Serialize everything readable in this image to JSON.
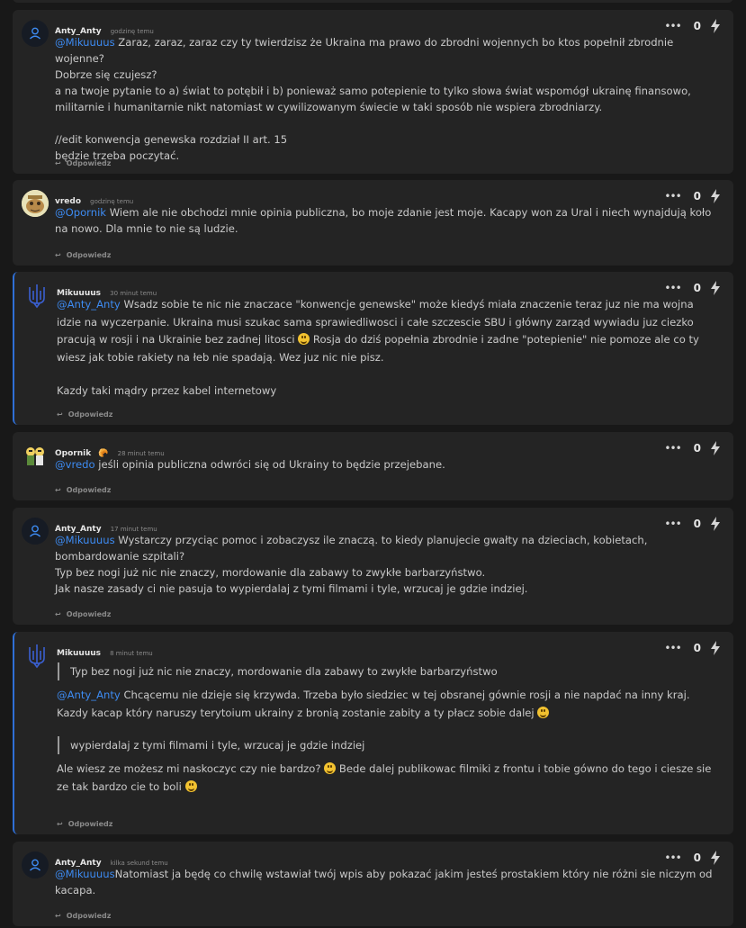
{
  "comments": [
    {
      "author": "Anty_Anty",
      "time": "godzinę temu",
      "score": "0",
      "reply_label": "Odpowiedz",
      "mention": "@Mikuuuus",
      "lines": [
        " Zaraz, zaraz, zaraz czy ty twierdzisz że Ukraina ma prawo do zbrodni wojennych bo ktos popełnił zbrodnie wojenne?",
        "Dobrze się czujesz?",
        "a na twoje pytanie to a) świat to potębił i b) ponieważ samo potepienie to tylko słowa świat wspomógł ukrainę finansowo, militarnie i humanitarnie nikt natomiast w cywilizowanym świecie w taki sposób nie wspiera zbrodniarzy.",
        "//edit konwencja genewska rozdział II art. 15",
        "będzie trzeba poczytać."
      ]
    },
    {
      "author": "vredo",
      "time": "godzinę temu",
      "score": "0",
      "reply_label": "Odpowiedz",
      "mention": "@Opornik",
      "text": " Wiem ale nie obchodzi mnie opinia publiczna, bo moje zdanie jest moje. Kacapy won za Ural i niech wynajdują koło na nowo. Dla mnie to nie są ludzie."
    },
    {
      "author": "Mikuuuus",
      "time": "30 minut temu",
      "score": "0",
      "reply_label": "Odpowiedz",
      "mention": "@Anty_Anty",
      "text_a": " Wsadz sobie te nic nie znaczace \"konwencje genewske\" może kiedyś miała znaczenie teraz juz nie ma wojna idzie na wyczerpanie. Ukraina musi szukac sama sprawiedliwosci i całe szczescie SBU i główny zarząd wywiadu juz ciezko pracują w rosji i na Ukrainie bez zadnej litosci ",
      "text_b": " Rosja do dziś popełnia zbrodnie i zadne \"potepienie\" nie pomoze ale co ty wiesz jak tobie rakiety na łeb nie spadają. Wez juz nic nie pisz.",
      "last": "Kazdy taki mądry przez kabel internetowy"
    },
    {
      "author": "Opornik",
      "time": "28 minut temu",
      "score": "0",
      "reply_label": "Odpowiedz",
      "mention": "@vredo",
      "text": " jeśli opinia publiczna odwróci się od Ukrainy to będzie przejebane."
    },
    {
      "author": "Anty_Anty",
      "time": "17 minut temu",
      "score": "0",
      "reply_label": "Odpowiedz",
      "mention": "@Mikuuuus",
      "text": " Wystarczy przyciąc pomoc i zobaczysz ile znaczą. to kiedy planujecie gwałty na dzieciach, kobietach, bombardowanie szpitali?",
      "line2": "Typ bez nogi już nic nie znaczy, mordowanie dla zabawy to zwykłe barbarzyństwo.",
      "line3": "Jak nasze zasady ci nie pasuja to wypierdalaj z tymi filmami i tyle, wrzucaj je gdzie indziej."
    },
    {
      "author": "Mikuuuus",
      "time": "8 minut temu",
      "score": "0",
      "reply_label": "Odpowiedz",
      "quote1": "Typ bez nogi już nic nie znaczy, mordowanie dla zabawy to zwykłe barbarzyństwo",
      "mention": "@Anty_Anty",
      "text1": " Chcącemu nie dzieje się krzywda. Trzeba było siedziec w tej obsranej gównie rosji a nie napdać na inny kraj. Kazdy kacap który naruszy terytoium ukrainy z bronią zostanie zabity a ty płacz sobie dalej ",
      "quote2": "wypierdalaj z tymi filmami i tyle, wrzucaj je gdzie indziej",
      "text2a": "Ale wiesz ze możesz mi naskoczyc czy nie bardzo? ",
      "text2b": " Bede dalej publikowac filmiki z frontu i tobie gówno do tego i ciesze sie ze tak bardzo cie to boli "
    },
    {
      "author": "Anty_Anty",
      "time": "kilka sekund temu",
      "score": "0",
      "reply_label": "Odpowiedz",
      "mention": "@Mikuuuus",
      "text": "Natomiast ja będę co chwilę wstawiał twój wpis aby pokazać jakim jesteś prostakiem który nie różni sie niczym od kacapa."
    }
  ],
  "colors": {
    "background": "#181818",
    "card": "#242424",
    "mention": "#3d8bf2",
    "highlight_border": "#2f6fd6"
  }
}
